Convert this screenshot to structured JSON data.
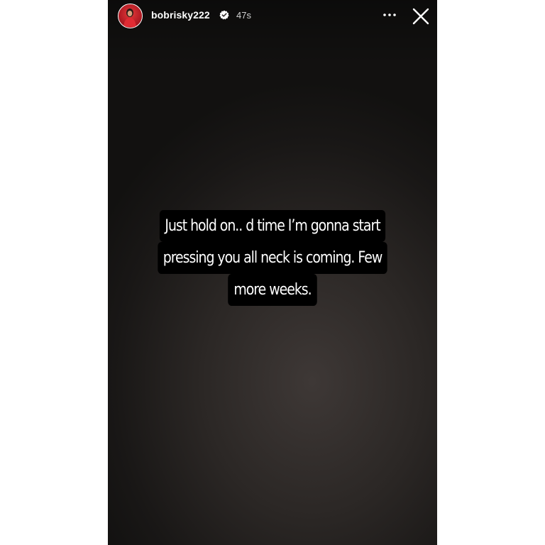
{
  "story": {
    "username": "bobrisky222",
    "timestamp": "47s",
    "verified": true,
    "caption_lines": [
      "Just hold on.. d time I’m gonna start",
      "pressing you all neck is coming. Few",
      "more weeks."
    ]
  },
  "icons": {
    "verified": "verified-badge-icon",
    "more": "more-options-icon",
    "close": "close-icon"
  },
  "colors": {
    "text": "#ffffff",
    "caption_background": "#000000",
    "avatar_accent": "#c0202a"
  }
}
